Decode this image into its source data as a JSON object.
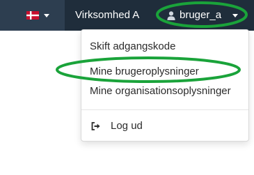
{
  "navbar": {
    "language_flag": "danish-flag-icon",
    "company_label": "Virksomhed A",
    "user_label": "bruger_a",
    "colors": {
      "bar": "#2d3e50",
      "active": "#1f2d3b"
    }
  },
  "user_menu": {
    "items": [
      {
        "label": "Skift adgangskode"
      },
      {
        "label": "Mine brugeroplysninger"
      },
      {
        "label": "Mine organisationsoplysninger"
      }
    ],
    "logout_label": "Log ud",
    "logout_icon": "sign-out-icon"
  },
  "annotation": {
    "color": "#1aa33a"
  }
}
